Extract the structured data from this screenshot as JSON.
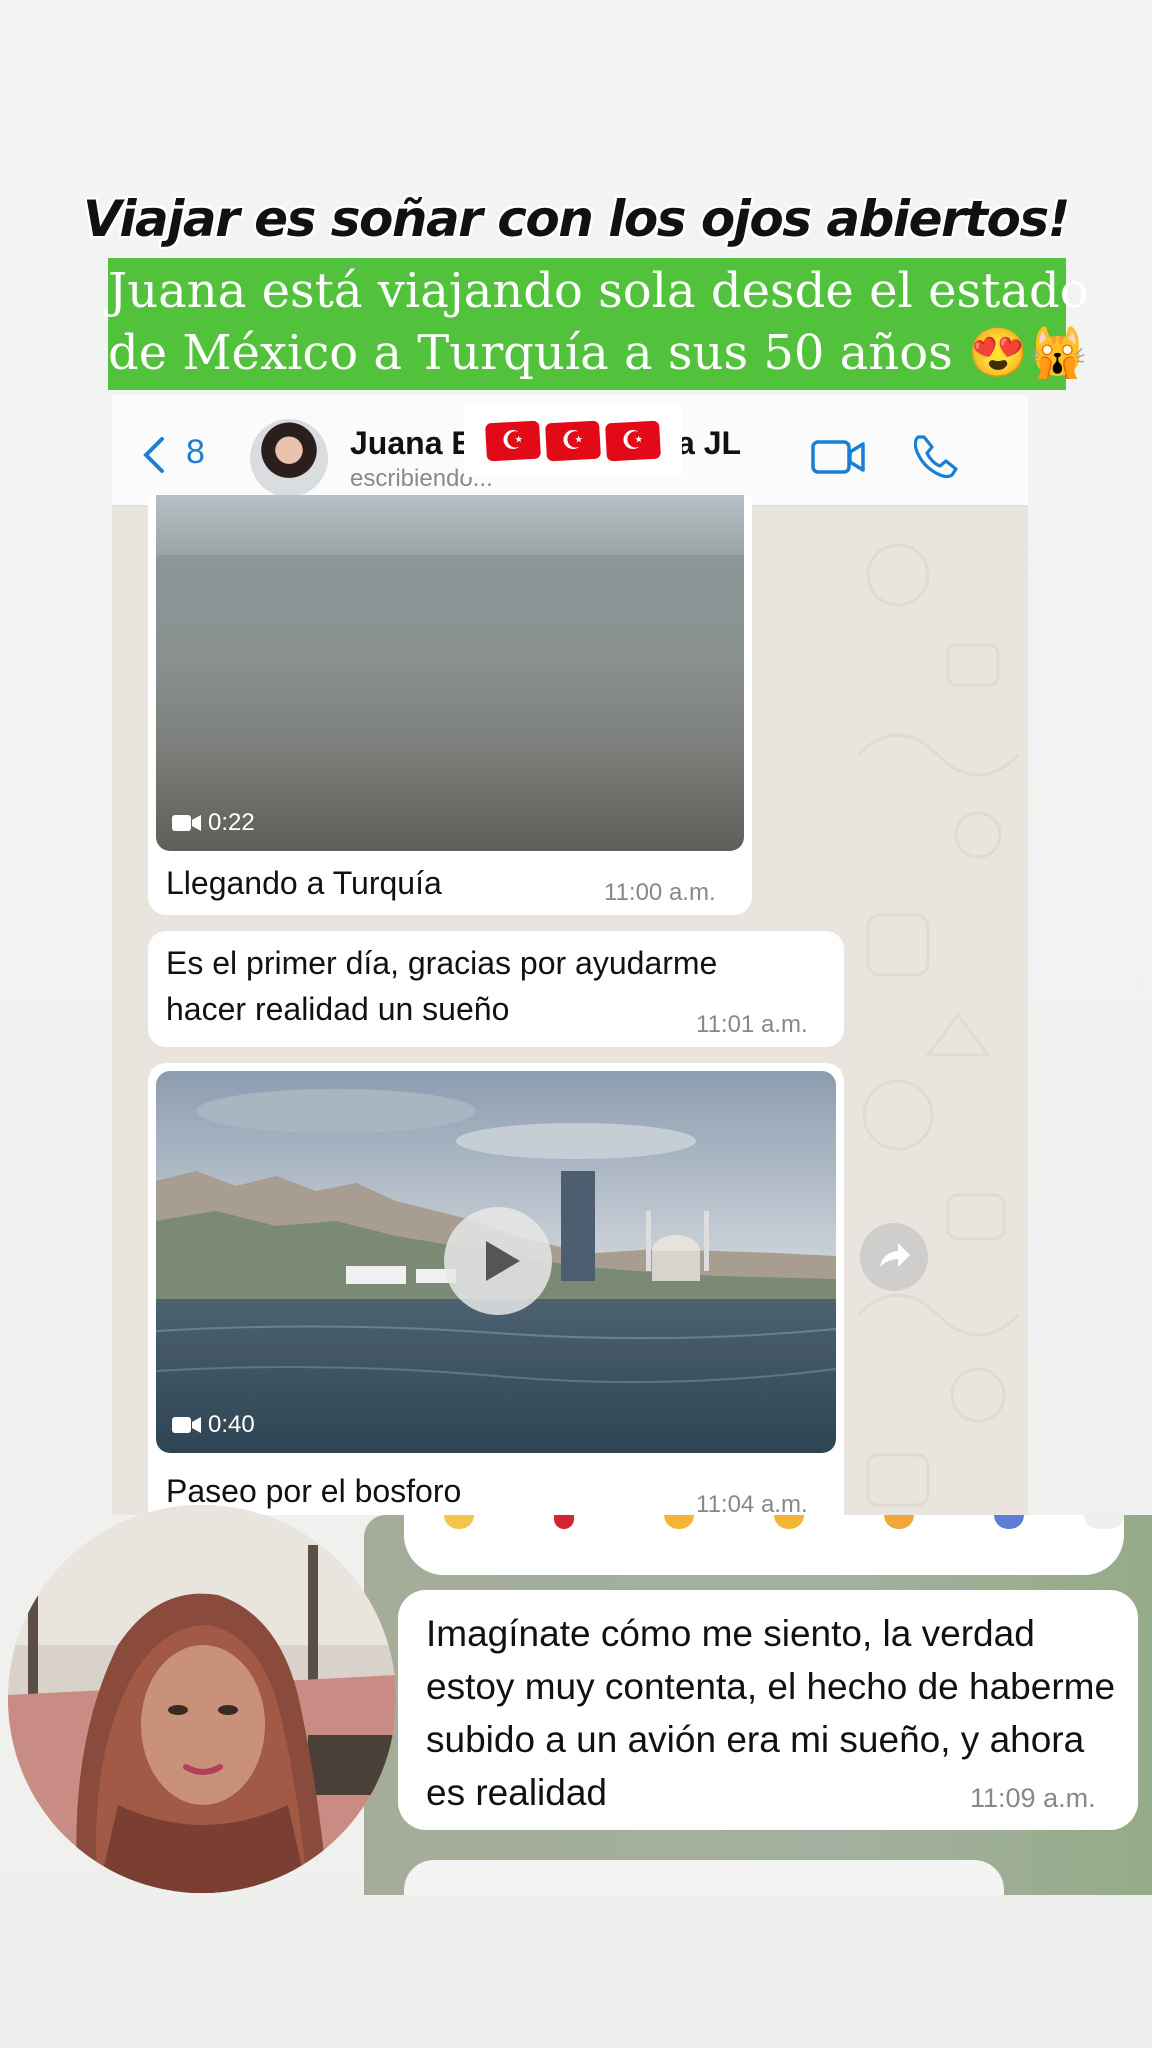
{
  "headline": "Viajar es soñar con los ojos abiertos!",
  "subtitle": {
    "line1": "Juana está viajando sola desde el estado",
    "line2": "de México a Turquía a sus 50 años 😍🙀"
  },
  "chat": {
    "back_count": "8",
    "contact_name_start": "Juana E",
    "contact_name_end": "a JL",
    "status": "escribiendo...",
    "flags": [
      "☪",
      "☪",
      "☪"
    ],
    "messages": [
      {
        "duration": "0:22",
        "caption": "Llegando a Turquía",
        "time": "11:00 a.m."
      },
      {
        "text_line1": "Es el primer día, gracias por ayudarme",
        "text_line2": "hacer realidad un sueño",
        "time": "11:01 a.m."
      },
      {
        "duration": "0:40",
        "caption": "Paseo por el bosforo",
        "time": "11:04 a.m."
      }
    ]
  },
  "overlay": {
    "message": "Imagínate cómo me siento, la verdad estoy muy contenta, el hecho de haberme subido a un avión era mi sueño, y ahora es realidad",
    "time": "11:09 a.m."
  },
  "colors": {
    "green_banner": "#52c13b",
    "ios_blue": "#1a7fd4",
    "turkey_red": "#e30a17"
  }
}
